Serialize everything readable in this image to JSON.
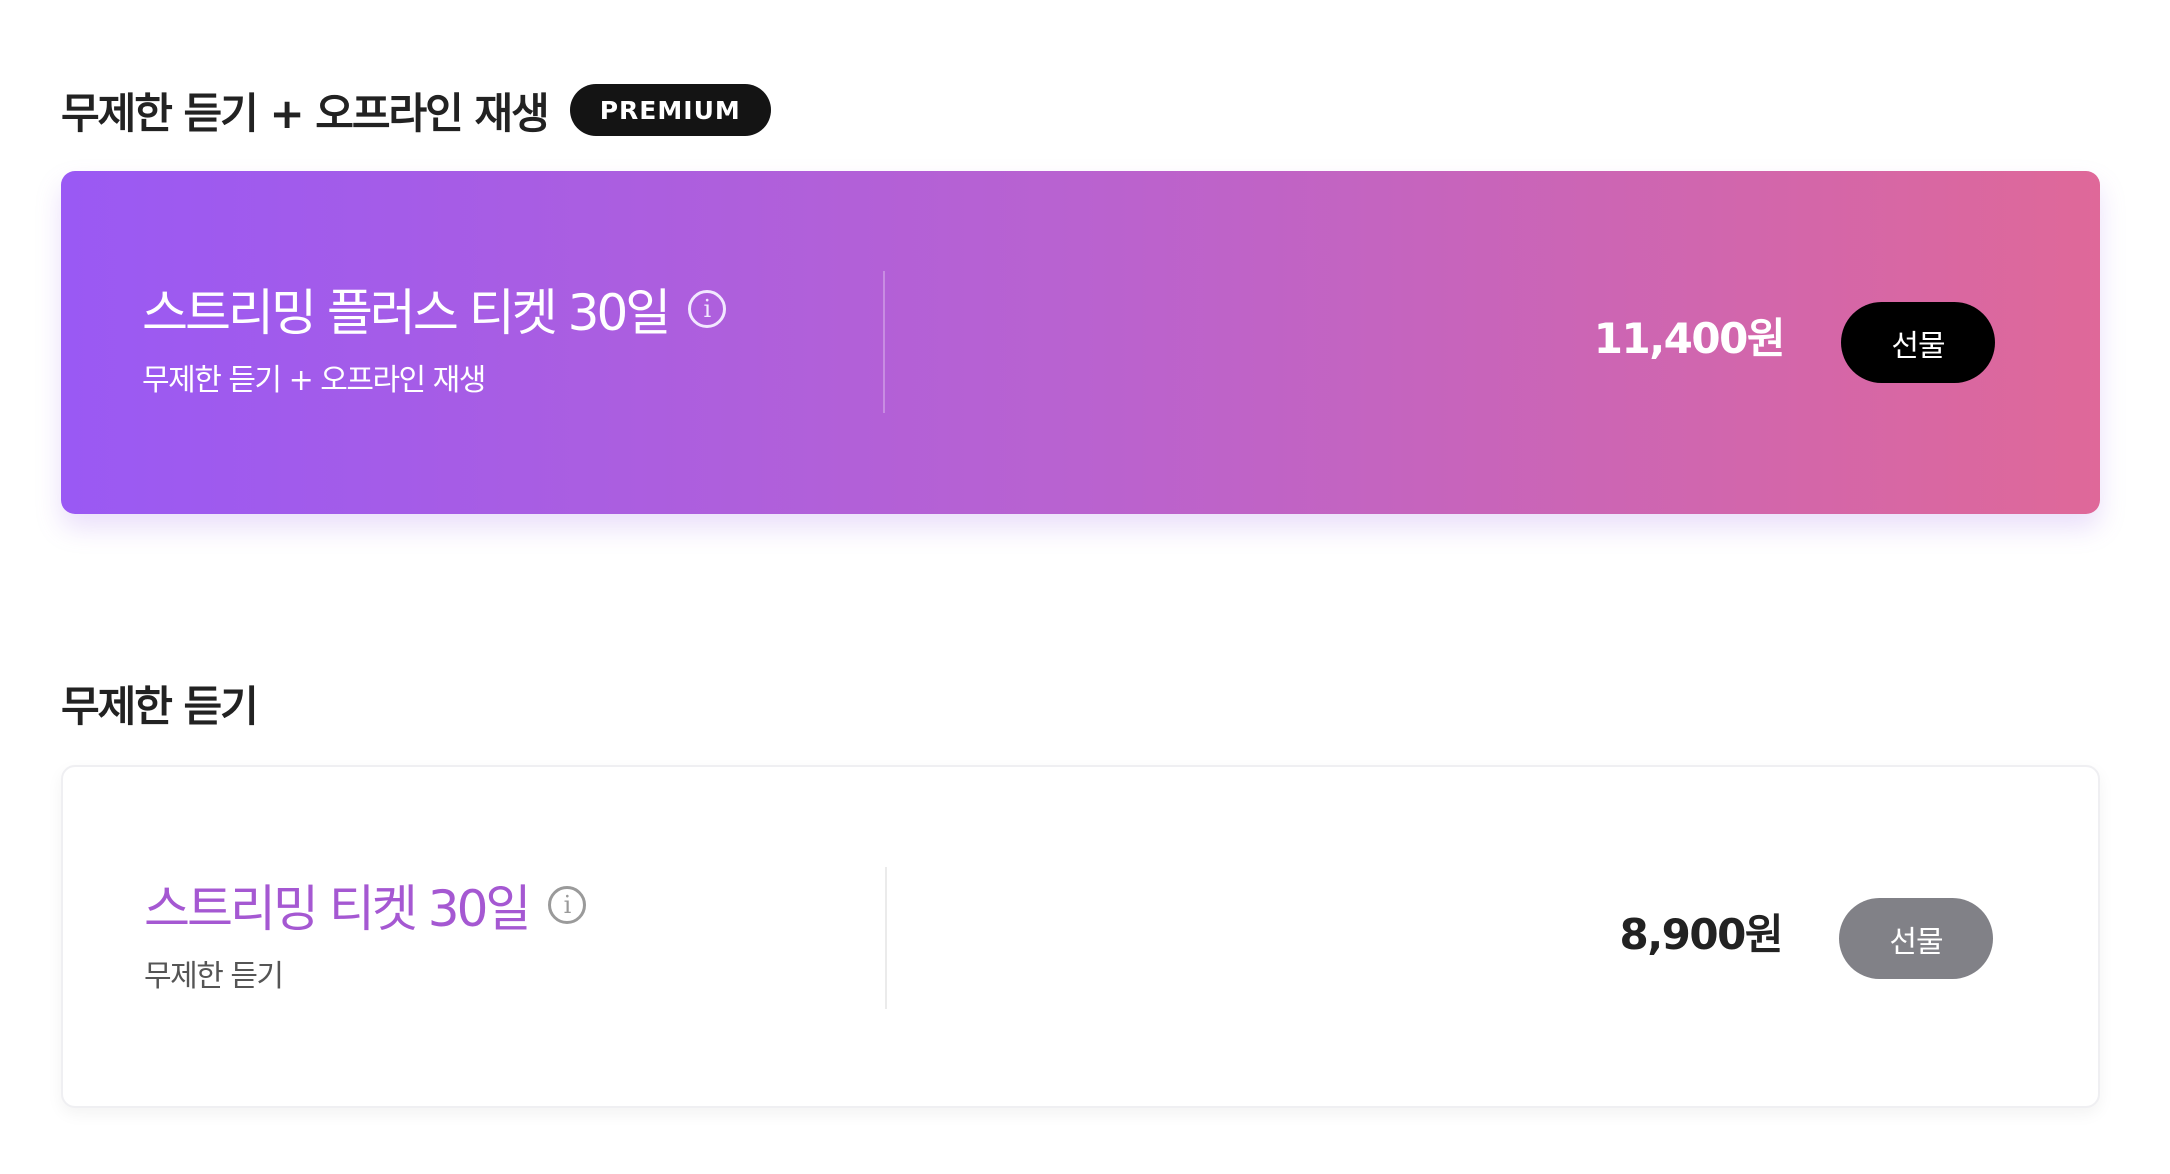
{
  "premium_section": {
    "title": "무제한 듣기 + 오프라인 재생",
    "badge": "PREMIUM",
    "ticket": {
      "name": "스트리밍 플러스 티켓 30일",
      "description": "무제한 듣기 + 오프라인 재생",
      "price": "11,400원",
      "gift_label": "선물",
      "info_glyph": "i"
    },
    "gradient_colors": [
      "#9a59f4",
      "#b962d0",
      "#df6899"
    ]
  },
  "basic_section": {
    "title": "무제한 듣기",
    "ticket": {
      "name": "스트리밍 티켓 30일",
      "description": "무제한 듣기",
      "price": "8,900원",
      "gift_label": "선물",
      "info_glyph": "i"
    },
    "accent_color": "#a558d2",
    "gift_button_color": "#818187"
  },
  "icons": {
    "premium_info": "info-circle-icon",
    "basic_info": "info-circle-icon"
  }
}
